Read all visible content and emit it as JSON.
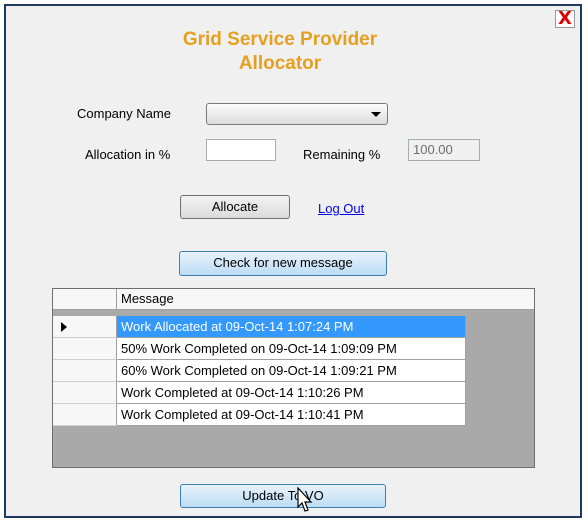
{
  "window": {
    "close_glyph": "X",
    "title_line1": "Grid Service Provider",
    "title_line2": "Allocator"
  },
  "form": {
    "company_label": "Company Name",
    "company_value": "",
    "allocation_label": "Allocation in %",
    "allocation_value": "",
    "remaining_label": "Remaining %",
    "remaining_value": "100.00"
  },
  "buttons": {
    "allocate": "Allocate",
    "logout": "Log Out",
    "check_messages": "Check for new message",
    "update": "Update To VO"
  },
  "grid": {
    "column_header": "Message",
    "rows": [
      "Work Allocated at 09-Oct-14 1:07:24 PM",
      "50% Work Completed on 09-Oct-14 1:09:09 PM",
      "60% Work Completed on 09-Oct-14 1:09:21 PM",
      "Work Completed at 09-Oct-14 1:10:26 PM",
      "Work Completed at 09-Oct-14 1:10:41 PM"
    ],
    "selected_index": 0
  },
  "colors": {
    "title": "#e6a020",
    "selection": "#3399ff",
    "close": "#e00000"
  },
  "icons": {
    "close": "close-icon",
    "dropdown": "chevron-down-icon",
    "row_indicator": "current-row-icon",
    "cursor": "mouse-pointer-icon"
  }
}
